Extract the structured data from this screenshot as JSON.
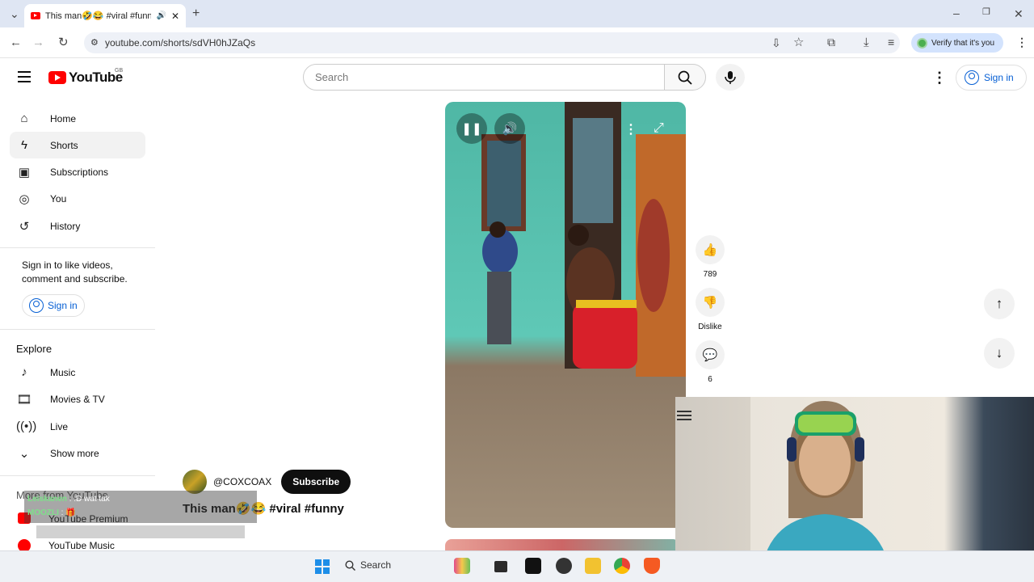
{
  "browser": {
    "tab_title": "This man🤣😂 #viral #funn",
    "url": "youtube.com/shorts/sdVH0hJZaQs",
    "verify_label": "Verify that it's you"
  },
  "header": {
    "logo_text": "YouTube",
    "region": "GB",
    "search_placeholder": "Search",
    "signin_label": "Sign in"
  },
  "sidebar": {
    "items": [
      {
        "label": "Home",
        "icon": "home-icon"
      },
      {
        "label": "Shorts",
        "icon": "shorts-icon"
      },
      {
        "label": "Subscriptions",
        "icon": "subscriptions-icon"
      },
      {
        "label": "You",
        "icon": "you-icon"
      },
      {
        "label": "History",
        "icon": "history-icon"
      }
    ],
    "signin_message": "Sign in to like videos, comment and subscribe.",
    "signin_button": "Sign in",
    "explore_heading": "Explore",
    "explore_items": [
      {
        "label": "Music",
        "icon": "music-icon"
      },
      {
        "label": "Movies & TV",
        "icon": "movies-icon"
      },
      {
        "label": "Live",
        "icon": "live-icon"
      },
      {
        "label": "Show more",
        "icon": "chevron-down-icon"
      }
    ],
    "more_from_heading": "More from YouTube",
    "more_from_items": [
      {
        "label": "YouTube Premium"
      },
      {
        "label": "YouTube Music"
      }
    ]
  },
  "short": {
    "channel": "@COXCOAX",
    "subscribe_label": "Subscribe",
    "title": "This man🤣😂 #viral #funny",
    "likes": "789",
    "dislike_label": "Dislike",
    "comments": "6"
  },
  "chat_overlay": {
    "line1_user": "Leiskanen",
    "line1_msg": ": :D wat tak",
    "line2_user": "MOOZLI",
    "line2_msg": ": 🎁"
  },
  "taskbar": {
    "search_label": "Search"
  }
}
